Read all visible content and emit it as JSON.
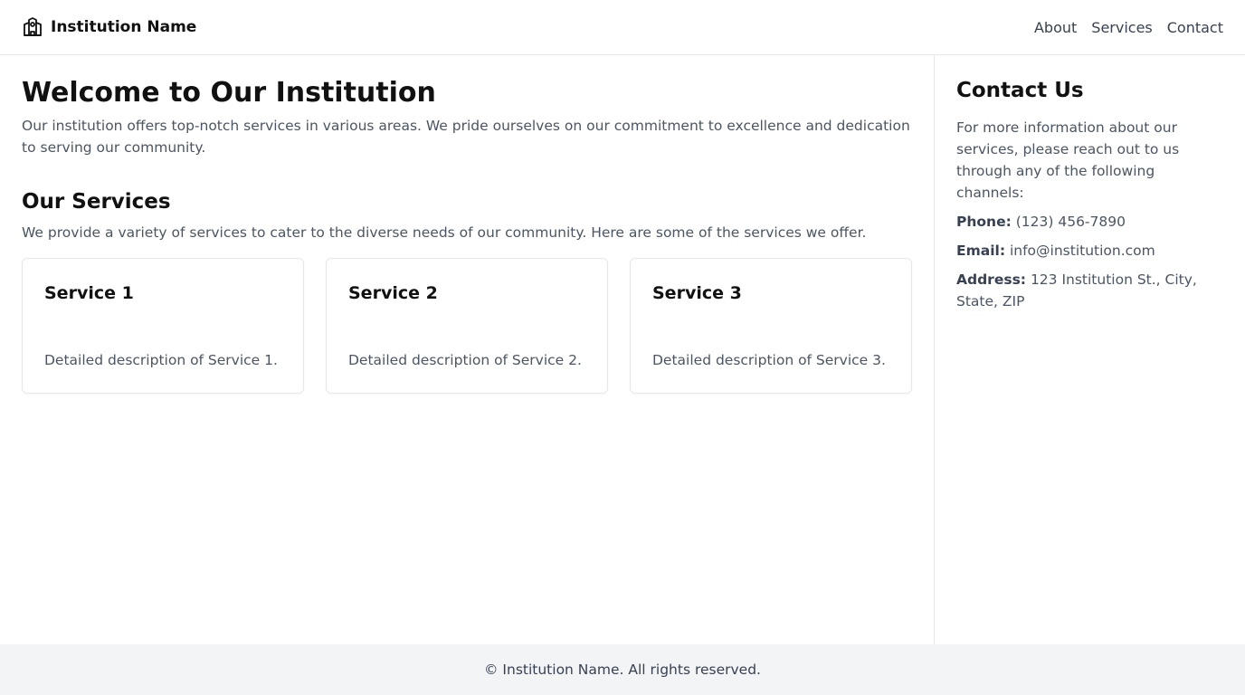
{
  "header": {
    "brand_name": "Institution Name",
    "brand_icon": "school-building-icon",
    "nav": [
      {
        "label": "About"
      },
      {
        "label": "Services"
      },
      {
        "label": "Contact"
      }
    ]
  },
  "main": {
    "title": "Welcome to Our Institution",
    "intro": "Our institution offers top-notch services in various areas. We pride ourselves on our commitment to excellence and dedication to serving our community.",
    "services_title": "Our Services",
    "services_desc": "We provide a variety of services to cater to the diverse needs of our community. Here are some of the services we offer.",
    "services": [
      {
        "title": "Service 1",
        "desc": "Detailed description of Service 1."
      },
      {
        "title": "Service 2",
        "desc": "Detailed description of Service 2."
      },
      {
        "title": "Service 3",
        "desc": "Detailed description of Service 3."
      }
    ]
  },
  "aside": {
    "title": "Contact Us",
    "intro": "For more information about our services, please reach out to us through any of the following channels:",
    "phone_label": "Phone:",
    "phone_value": "(123) 456-7890",
    "email_label": "Email:",
    "email_value": "info@institution.com",
    "address_label": "Address:",
    "address_value": "123 Institution St., City, State, ZIP"
  },
  "footer": {
    "text": "© Institution Name. All rights reserved."
  },
  "colors": {
    "text_primary": "#111111",
    "text_secondary": "#4b5563",
    "border": "#e5e7eb",
    "footer_bg": "#f3f4f6"
  }
}
